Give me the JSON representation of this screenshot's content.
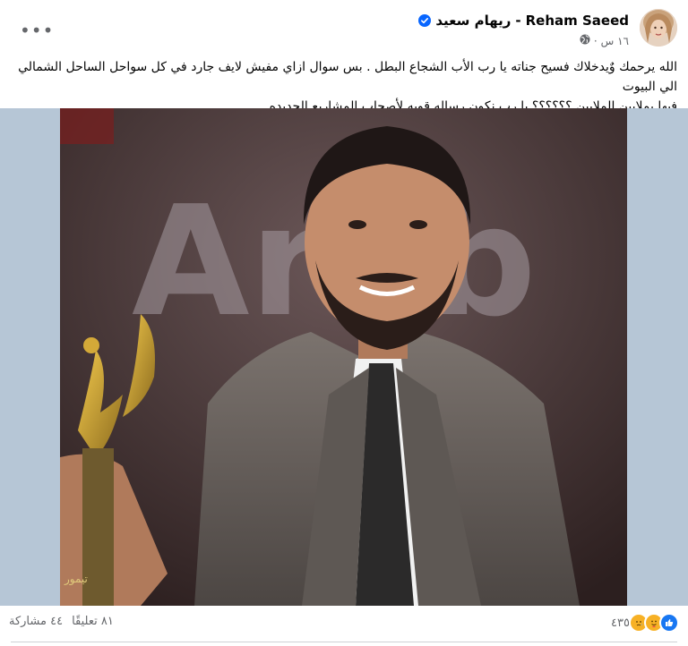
{
  "post": {
    "author_english": "Reham Saeed",
    "author_separator": "-",
    "author_arabic": "ريهام سعيد",
    "time": "١٦ س",
    "dot": "·",
    "caption_line1": "الله يرحمك وٌيدخلاك فسيح جناته يا رب الأب  الشجاع البطل . بس سوال ازاي مفيش لايف جارد في كل سواحل الساحل الشمالي الي البيوت",
    "caption_line2": "فيها بملايين الملايين ؟؟؟؟؟؟ يا رب نكون رساله قويه لأصحاب المشاريع الجديده"
  },
  "footer": {
    "reaction_count": "٤٣٥",
    "comments": "٨١ تعليقًا",
    "shares": "٤٤ مشاركة"
  },
  "colors": {
    "verified": "#0866ff",
    "like": "#1877f2",
    "care": "#f7b125",
    "muted": "#65676b"
  },
  "icons": [
    "more-options-icon",
    "verified-badge-icon",
    "globe-icon",
    "like-reaction-icon",
    "care-reaction-icon",
    "sad-reaction-icon"
  ]
}
